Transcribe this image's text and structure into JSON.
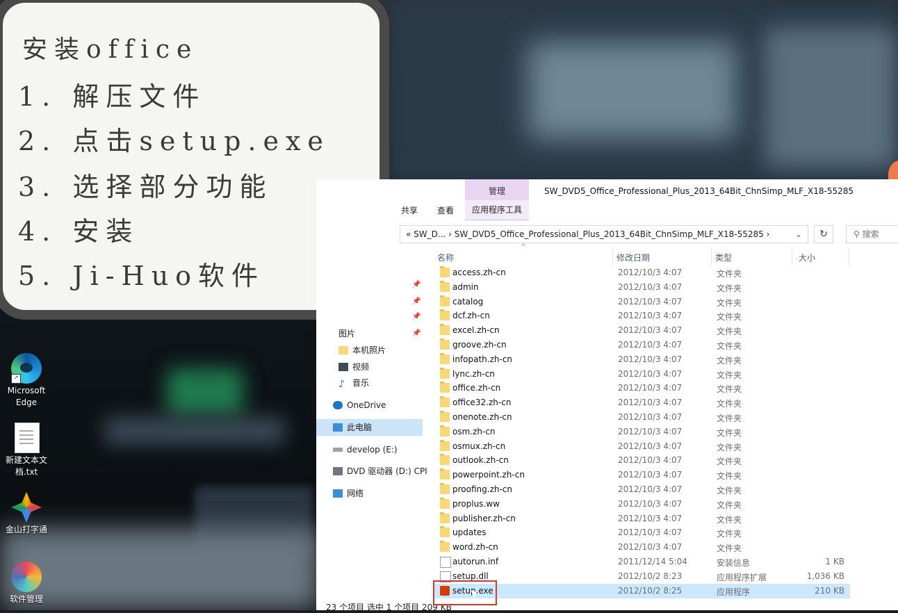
{
  "note": {
    "title": "安装office",
    "steps": [
      "1. 解压文件",
      "2. 点击setup.exe",
      "3. 选择部分功能",
      "4. 安装",
      "5. Ji-Huo软件"
    ]
  },
  "desktop": {
    "icons": [
      {
        "label": "Microsoft Edge",
        "icon": "edge-icon"
      },
      {
        "label": "新建文本文档.txt",
        "icon": "text-file-icon"
      },
      {
        "label": "金山打字通",
        "icon": "typing-app-icon"
      },
      {
        "label": "软件管理",
        "icon": "software-manager-icon"
      }
    ]
  },
  "explorer": {
    "ribbon": {
      "share": "共享",
      "view": "查看",
      "context_header": "管理",
      "context_tab": "应用程序工具"
    },
    "window_title": "SW_DVD5_Office_Professional_Plus_2013_64Bit_ChnSimp_MLF_X18-55285",
    "address": "«  SW_D...  ›  SW_DVD5_Office_Professional_Plus_2013_64Bit_ChnSimp_MLF_X18-55285  ›",
    "search_placeholder": "搜索",
    "nav": [
      {
        "label": "图片",
        "icon": "pictures-icon"
      },
      {
        "label": "本机照片",
        "icon": "folder-icon"
      },
      {
        "label": "视频",
        "icon": "video-icon"
      },
      {
        "label": "音乐",
        "icon": "music-icon"
      },
      {
        "label": "OneDrive",
        "icon": "cloud-icon"
      },
      {
        "label": "此电脑",
        "icon": "computer-icon"
      },
      {
        "label": "develop (E:)",
        "icon": "drive-icon"
      },
      {
        "label": "DVD 驱动器 (D:) CPI",
        "icon": "dvd-icon"
      },
      {
        "label": "网络",
        "icon": "network-icon"
      }
    ],
    "columns": {
      "name": "名称",
      "date": "修改日期",
      "type": "类型",
      "size": "大小"
    },
    "files": [
      {
        "name": "access.zh-cn",
        "date": "2012/10/3 4:07",
        "type": "文件夹",
        "size": ""
      },
      {
        "name": "admin",
        "date": "2012/10/3 4:07",
        "type": "文件夹",
        "size": ""
      },
      {
        "name": "catalog",
        "date": "2012/10/3 4:07",
        "type": "文件夹",
        "size": ""
      },
      {
        "name": "dcf.zh-cn",
        "date": "2012/10/3 4:07",
        "type": "文件夹",
        "size": ""
      },
      {
        "name": "excel.zh-cn",
        "date": "2012/10/3 4:07",
        "type": "文件夹",
        "size": ""
      },
      {
        "name": "groove.zh-cn",
        "date": "2012/10/3 4:07",
        "type": "文件夹",
        "size": ""
      },
      {
        "name": "infopath.zh-cn",
        "date": "2012/10/3 4:07",
        "type": "文件夹",
        "size": ""
      },
      {
        "name": "lync.zh-cn",
        "date": "2012/10/3 4:07",
        "type": "文件夹",
        "size": ""
      },
      {
        "name": "office.zh-cn",
        "date": "2012/10/3 4:07",
        "type": "文件夹",
        "size": ""
      },
      {
        "name": "office32.zh-cn",
        "date": "2012/10/3 4:07",
        "type": "文件夹",
        "size": ""
      },
      {
        "name": "onenote.zh-cn",
        "date": "2012/10/3 4:07",
        "type": "文件夹",
        "size": ""
      },
      {
        "name": "osm.zh-cn",
        "date": "2012/10/3 4:07",
        "type": "文件夹",
        "size": ""
      },
      {
        "name": "osmux.zh-cn",
        "date": "2012/10/3 4:07",
        "type": "文件夹",
        "size": ""
      },
      {
        "name": "outlook.zh-cn",
        "date": "2012/10/3 4:07",
        "type": "文件夹",
        "size": ""
      },
      {
        "name": "powerpoint.zh-cn",
        "date": "2012/10/3 4:07",
        "type": "文件夹",
        "size": ""
      },
      {
        "name": "proofing.zh-cn",
        "date": "2012/10/3 4:07",
        "type": "文件夹",
        "size": ""
      },
      {
        "name": "proplus.ww",
        "date": "2012/10/3 4:07",
        "type": "文件夹",
        "size": ""
      },
      {
        "name": "publisher.zh-cn",
        "date": "2012/10/3 4:07",
        "type": "文件夹",
        "size": ""
      },
      {
        "name": "updates",
        "date": "2012/10/3 4:07",
        "type": "文件夹",
        "size": ""
      },
      {
        "name": "word.zh-cn",
        "date": "2012/10/3 4:07",
        "type": "文件夹",
        "size": ""
      },
      {
        "name": "autorun.inf",
        "date": "2011/12/14 5:04",
        "type": "安装信息",
        "size": "1 KB"
      },
      {
        "name": "setup.dll",
        "date": "2012/10/2 8:23",
        "type": "应用程序扩展",
        "size": "1,036 KB"
      },
      {
        "name": "setup.exe",
        "date": "2012/10/2 8:25",
        "type": "应用程序",
        "size": "210 KB"
      }
    ],
    "status": "23 个项目    选中 1 个项目  209 KB"
  }
}
